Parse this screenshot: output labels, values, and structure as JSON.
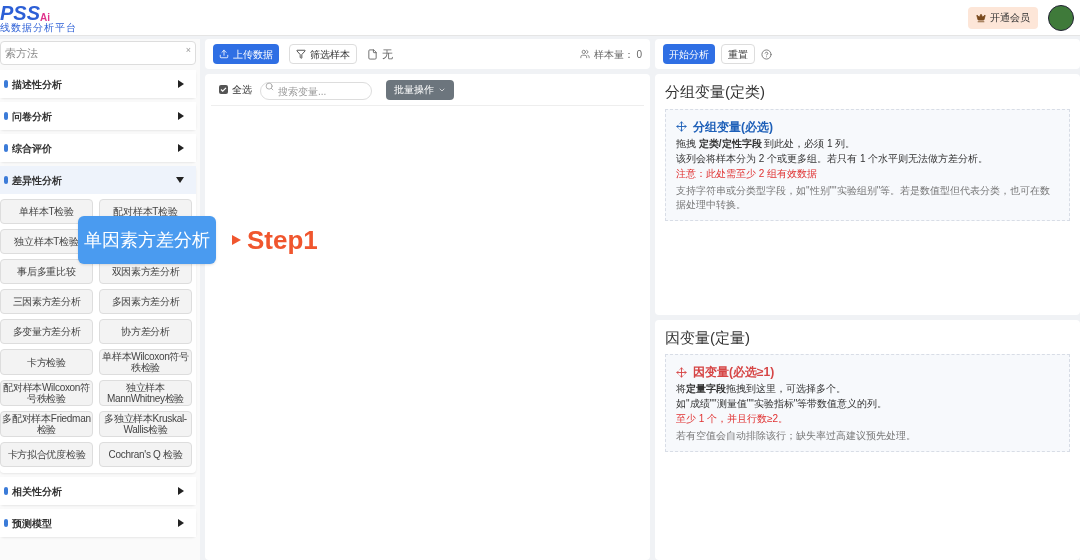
{
  "header": {
    "logo": "PSS",
    "logo_suffix": "Ai",
    "logo_subtitle": "线数据分析平台",
    "vip_button": "开通会员"
  },
  "sidebar": {
    "search": {
      "placeholder": "索方法",
      "clear": "×"
    },
    "sections": [
      {
        "label": "描述性分析",
        "expanded": false
      },
      {
        "label": "问卷分析",
        "expanded": false
      },
      {
        "label": "综合评价",
        "expanded": false
      },
      {
        "label": "差异性分析",
        "expanded": true,
        "methods": [
          {
            "kind": "method",
            "label": "单样本T检验"
          },
          {
            "kind": "method",
            "label": "配对样本T检验"
          },
          {
            "kind": "method",
            "label": "独立样本T检验"
          },
          {
            "kind": "covered"
          },
          {
            "kind": "method",
            "label": "事后多重比较"
          },
          {
            "kind": "method",
            "label": "双因素方差分析"
          },
          {
            "kind": "method",
            "label": "三因素方差分析"
          },
          {
            "kind": "method",
            "label": "多因素方差分析"
          },
          {
            "kind": "method",
            "label": "多变量方差分析"
          },
          {
            "kind": "method",
            "label": "协方差分析"
          },
          {
            "kind": "method",
            "label": "卡方检验"
          },
          {
            "kind": "method",
            "label": "单样本Wilcoxon符号秩检验"
          },
          {
            "kind": "method",
            "label": "配对样本Wilcoxon符号秩检验"
          },
          {
            "kind": "method",
            "label": "独立样本MannWhitney检验"
          },
          {
            "kind": "method",
            "label": "多配对样本Friedman检验"
          },
          {
            "kind": "method",
            "label": "多独立样本Kruskal-Wallis检验"
          },
          {
            "kind": "method",
            "label": "卡方拟合优度检验"
          },
          {
            "kind": "method",
            "label": "Cochran's Q 检验"
          }
        ]
      },
      {
        "label": "相关性分析",
        "expanded": false
      },
      {
        "label": "预测模型",
        "expanded": false
      }
    ]
  },
  "data_panel": {
    "upload_button": "上传数据",
    "filter_button": "筛选样本",
    "file_name": "无",
    "sample_count_label": "样本量：",
    "sample_count": "0",
    "select_all": {
      "label": "全选",
      "checked": true
    },
    "variable_search": {
      "placeholder": "搜索变量..."
    },
    "batch_button": "批量操作"
  },
  "analysis_panel": {
    "start_button": "开始分析",
    "reset_button": "重置",
    "zones": [
      {
        "kind": "grouping",
        "title": "分组变量(定类)",
        "drop_title": "分组变量(必选)",
        "lines": [
          "拖拽 **定类/定性字段** 到此处，必须 1 列。",
          "该列会将样本分为 2 个或更多组。若只有 1 个水平则无法做方差分析。"
        ],
        "warning": "注意：此处需至少 2 组有效数据",
        "note": "支持字符串或分类型字段，如\"性别\"\"实验组别\"等。若是数值型但代表分类，也可在数据处理中转换。"
      },
      {
        "kind": "dependent",
        "title": "因变量(定量)",
        "drop_title": "因变量(必选≥1)",
        "lines": [
          "将**定量字段**拖拽到这里，可选择多个。",
          "如\"成绩\"\"测量值\"\"实验指标\"等带数值意义的列。"
        ],
        "warning": "至少 1 个，并且行数≥2。",
        "note": "若有空值会自动排除该行；缺失率过高建议预先处理。"
      }
    ]
  },
  "callout": {
    "label": "单因素方差分析",
    "step": "Step1"
  }
}
